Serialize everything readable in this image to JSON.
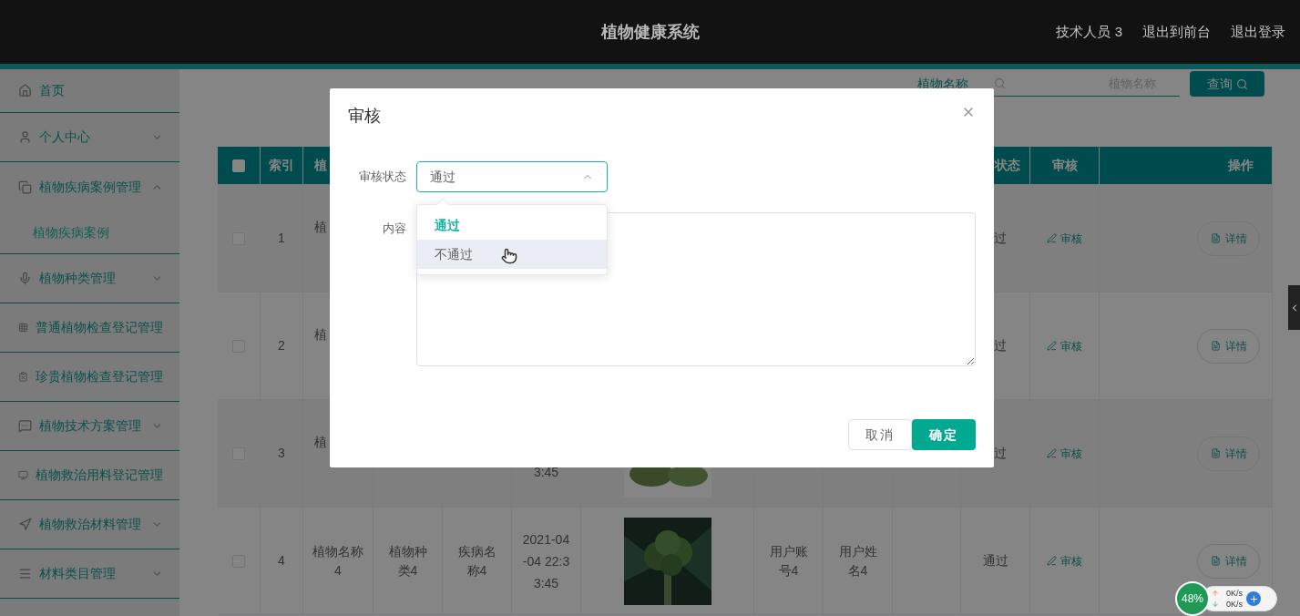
{
  "header": {
    "title": "植物健康系统",
    "user": "技术人员 3",
    "links": [
      "退出到前台",
      "退出登录"
    ]
  },
  "sidebar": {
    "items": [
      {
        "kind": "link",
        "label": "首页"
      },
      {
        "kind": "group",
        "label": "个人中心",
        "expanded": false
      },
      {
        "kind": "group",
        "label": "植物疾病案例管理",
        "expanded": true,
        "children": [
          {
            "label": "植物疾病案例"
          }
        ]
      },
      {
        "kind": "group",
        "label": "植物种类管理",
        "expanded": false
      },
      {
        "kind": "link",
        "label": "普通植物检查登记管理"
      },
      {
        "kind": "link",
        "label": "珍贵植物检查登记管理"
      },
      {
        "kind": "group",
        "label": "植物技术方案管理",
        "expanded": false
      },
      {
        "kind": "link",
        "label": "植物救治用料登记管理"
      },
      {
        "kind": "group",
        "label": "植物救治材料管理",
        "expanded": false
      },
      {
        "kind": "group",
        "label": "材料类目管理",
        "expanded": false
      }
    ]
  },
  "search": {
    "label": "植物名称",
    "placeholder": "植物名称",
    "button": "查询"
  },
  "table": {
    "header": {
      "select_all": {
        "checked": false
      },
      "index": "索引",
      "name": "植",
      "status": "状态",
      "review": "审核",
      "actions": "操作"
    },
    "rows": [
      {
        "checked": false,
        "covered": true,
        "index": "1",
        "name": "植",
        "status": "过",
        "review": "审核",
        "detail": "详情"
      },
      {
        "checked": false,
        "covered": true,
        "index": "2",
        "name": "植",
        "status": "过",
        "review": "审核",
        "detail": "详情"
      },
      {
        "checked": false,
        "covered": true,
        "index": "3",
        "name": "植",
        "date": "3:45",
        "status": "过",
        "review": "审核",
        "detail": "详情"
      },
      {
        "checked": false,
        "covered": false,
        "index": "4",
        "name": "植物名称4",
        "species": "植物种类4",
        "disease": "疾病名称4",
        "date": "2021-04-04 22:33:45",
        "account": "用户账号4",
        "username": "用户姓名4",
        "status": "通过",
        "review": "审核",
        "detail": "详情"
      }
    ]
  },
  "dialog": {
    "title": "审核",
    "status_label": "审核状态",
    "status_value": "通过",
    "status_open": true,
    "options": [
      {
        "label": "通过",
        "selected": true,
        "hovered": false
      },
      {
        "label": "不通过",
        "selected": false,
        "hovered": true
      }
    ],
    "content_label": "内容",
    "buttons": [
      {
        "kind": "secondary",
        "label": "取消"
      },
      {
        "kind": "primary",
        "label": "确定"
      }
    ]
  },
  "net_monitor": {
    "percent": "48%",
    "upload": "0K/s",
    "download": "0K/s"
  }
}
